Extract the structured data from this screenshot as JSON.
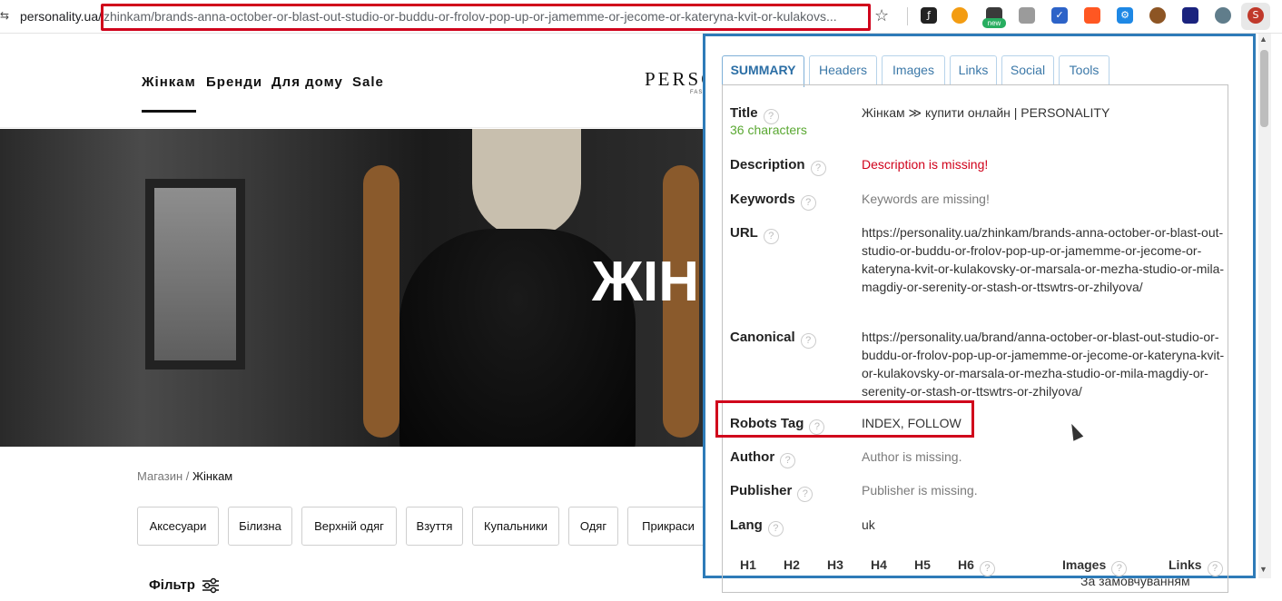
{
  "browser": {
    "site_icon": "⇆",
    "url_domain": "personality.ua/",
    "url_path": "zhinkam/brands-anna-october-or-blast-out-studio-or-buddu-or-frolov-pop-up-or-jamemme-or-jecome-or-kateryna-kvit-or-kulakovs...",
    "star_icon": "☆",
    "new_badge": "new"
  },
  "page": {
    "nav": [
      "Жінкам",
      "Бренди",
      "Для дому",
      "Sale"
    ],
    "logo": "PERSO",
    "logo_sub": "FAS",
    "hero_title": "ЖІН",
    "breadcrumb_root": "Магазин",
    "breadcrumb_sep": "/",
    "breadcrumb_current": "Жінкам",
    "categories": [
      "Аксесуари",
      "Білизна",
      "Верхній одяг",
      "Взуття",
      "Купальники",
      "Одяг",
      "Прикраси"
    ],
    "filter_label": "Фільтр",
    "sort_label": "За замовчуванням"
  },
  "panel": {
    "tabs": [
      "SUMMARY",
      "Headers",
      "Images",
      "Links",
      "Social",
      "Tools"
    ],
    "help": "?",
    "title_label": "Title",
    "title_value": "Жінкам ≫ купити онлайн | PERSONALITY",
    "title_chars": "36 characters",
    "description_label": "Description",
    "description_value": "Description is missing!",
    "keywords_label": "Keywords",
    "keywords_value": "Keywords are missing!",
    "url_label": "URL",
    "url_value": "https://personality.ua/zhinkam/brands-anna-october-or-blast-out-studio-or-buddu-or-frolov-pop-up-or-jamemme-or-jecome-or-kateryna-kvit-or-kulakovsky-or-marsala-or-mezha-studio-or-mila-magdiy-or-serenity-or-stash-or-ttswtrs-or-zhilyova/",
    "canonical_label": "Canonical",
    "canonical_value": "https://personality.ua/brand/anna-october-or-blast-out-studio-or-buddu-or-frolov-pop-up-or-jamemme-or-jecome-or-kateryna-kvit-or-kulakovsky-or-marsala-or-mezha-studio-or-mila-magdiy-or-serenity-or-stash-or-ttswtrs-or-zhilyova/",
    "robots_label": "Robots Tag",
    "robots_value": "INDEX, FOLLOW",
    "author_label": "Author",
    "author_value": "Author is missing.",
    "publisher_label": "Publisher",
    "publisher_value": "Publisher is missing.",
    "lang_label": "Lang",
    "lang_value": "uk",
    "headings": [
      "H1",
      "H2",
      "H3",
      "H4",
      "H5",
      "H6"
    ],
    "images_label": "Images",
    "links_label": "Links"
  },
  "colors": {
    "accent": "#2e7bb8",
    "highlight": "#d0021b",
    "ok": "#5aa832"
  }
}
